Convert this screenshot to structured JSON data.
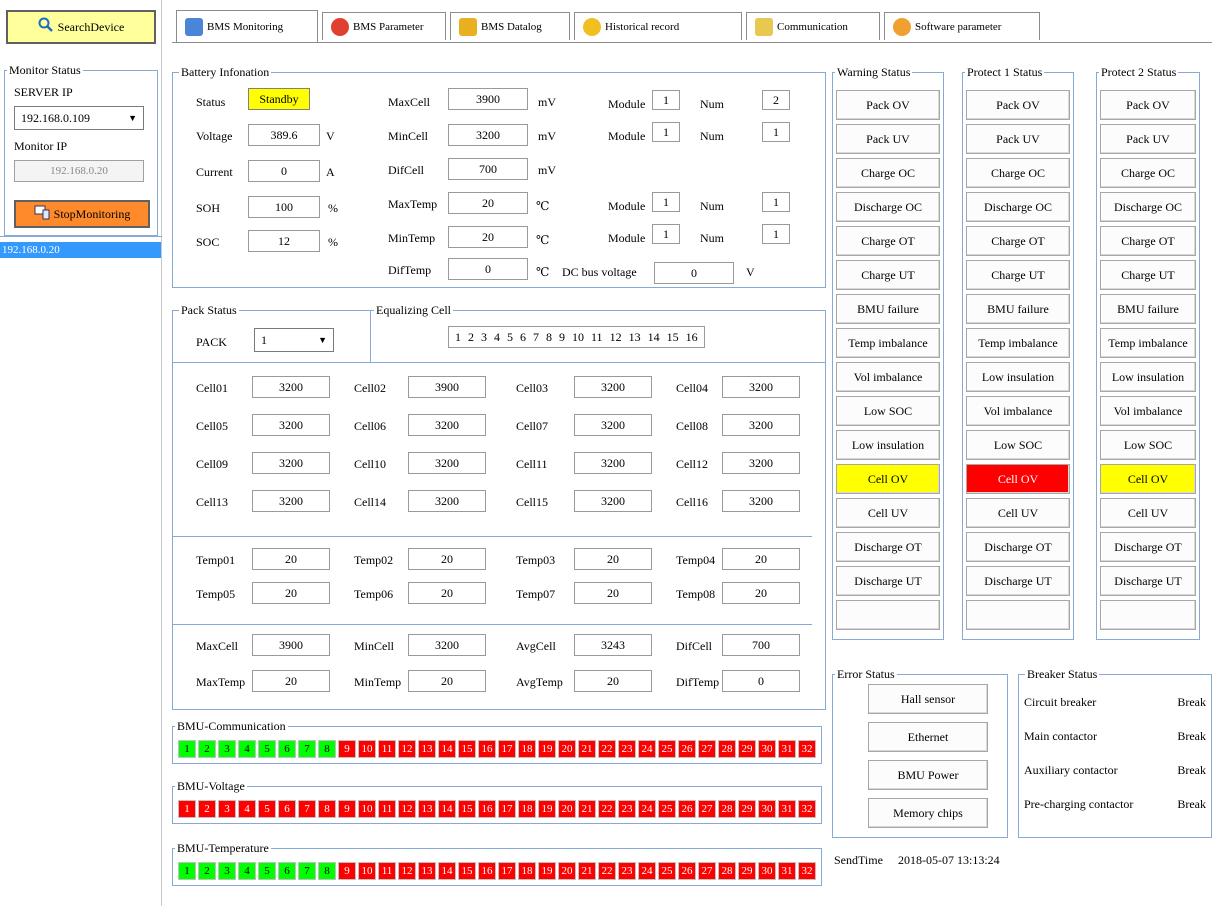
{
  "left": {
    "search_label": "SearchDevice",
    "monitor_status_title": "Monitor Status",
    "server_ip_label": "SERVER IP",
    "server_ip_value": "192.168.0.109",
    "monitor_ip_label": "Monitor IP",
    "monitor_ip_value": "192.168.0.20",
    "stop_label": "StopMonitoring",
    "devices": [
      "192.168.0.20"
    ]
  },
  "tabs": [
    {
      "label": "BMS Monitoring",
      "active": true
    },
    {
      "label": "BMS Parameter"
    },
    {
      "label": "BMS Datalog"
    },
    {
      "label": "Historical record"
    },
    {
      "label": "Communication"
    },
    {
      "label": "Software parameter"
    }
  ],
  "battery": {
    "title": "Battery Infonation",
    "status_label": "Status",
    "status_value": "Standby",
    "voltage_label": "Voltage",
    "voltage_value": "389.6",
    "voltage_unit": "V",
    "current_label": "Current",
    "current_value": "0",
    "current_unit": "A",
    "soh_label": "SOH",
    "soh_value": "100",
    "soh_unit": "%",
    "soc_label": "SOC",
    "soc_value": "12",
    "soc_unit": "%",
    "maxcell_label": "MaxCell",
    "maxcell_value": "3900",
    "maxcell_unit": "mV",
    "mincell_label": "MinCell",
    "mincell_value": "3200",
    "mincell_unit": "mV",
    "difcell_label": "DifCell",
    "difcell_value": "700",
    "difcell_unit": "mV",
    "maxtemp_label": "MaxTemp",
    "maxtemp_value": "20",
    "maxtemp_unit": "℃",
    "mintemp_label": "MinTemp",
    "mintemp_value": "20",
    "mintemp_unit": "℃",
    "diftemp_label": "DifTemp",
    "diftemp_value": "0",
    "diftemp_unit": "℃",
    "module_label": "Module",
    "num_label": "Num",
    "maxcell_module": "1",
    "maxcell_num": "2",
    "mincell_module": "1",
    "mincell_num": "1",
    "maxtemp_module": "1",
    "maxtemp_num": "1",
    "mintemp_module": "1",
    "mintemp_num": "1",
    "dcbus_label": "DC bus voltage",
    "dcbus_value": "0",
    "dcbus_unit": "V"
  },
  "pack": {
    "title": "Pack Status",
    "pack_label": "PACK",
    "pack_value": "1",
    "equalizing_title": "Equalizing Cell",
    "equalizing_cells": [
      "1",
      "2",
      "3",
      "4",
      "5",
      "6",
      "7",
      "8",
      "9",
      "10",
      "11",
      "12",
      "13",
      "14",
      "15",
      "16"
    ],
    "cells": [
      {
        "label": "Cell01",
        "value": "3200"
      },
      {
        "label": "Cell02",
        "value": "3900"
      },
      {
        "label": "Cell03",
        "value": "3200"
      },
      {
        "label": "Cell04",
        "value": "3200"
      },
      {
        "label": "Cell05",
        "value": "3200"
      },
      {
        "label": "Cell06",
        "value": "3200"
      },
      {
        "label": "Cell07",
        "value": "3200"
      },
      {
        "label": "Cell08",
        "value": "3200"
      },
      {
        "label": "Cell09",
        "value": "3200"
      },
      {
        "label": "Cell10",
        "value": "3200"
      },
      {
        "label": "Cell11",
        "value": "3200"
      },
      {
        "label": "Cell12",
        "value": "3200"
      },
      {
        "label": "Cell13",
        "value": "3200"
      },
      {
        "label": "Cell14",
        "value": "3200"
      },
      {
        "label": "Cell15",
        "value": "3200"
      },
      {
        "label": "Cell16",
        "value": "3200"
      }
    ],
    "temps": [
      {
        "label": "Temp01",
        "value": "20"
      },
      {
        "label": "Temp02",
        "value": "20"
      },
      {
        "label": "Temp03",
        "value": "20"
      },
      {
        "label": "Temp04",
        "value": "20"
      },
      {
        "label": "Temp05",
        "value": "20"
      },
      {
        "label": "Temp06",
        "value": "20"
      },
      {
        "label": "Temp07",
        "value": "20"
      },
      {
        "label": "Temp08",
        "value": "20"
      }
    ],
    "summary": [
      {
        "label": "MaxCell",
        "value": "3900"
      },
      {
        "label": "MinCell",
        "value": "3200"
      },
      {
        "label": "AvgCell",
        "value": "3243"
      },
      {
        "label": "DifCell",
        "value": "700"
      },
      {
        "label": "MaxTemp",
        "value": "20"
      },
      {
        "label": "MinTemp",
        "value": "20"
      },
      {
        "label": "AvgTemp",
        "value": "20"
      },
      {
        "label": "DifTemp",
        "value": "0"
      }
    ]
  },
  "bmu": {
    "communication_title": "BMU-Communication",
    "voltage_title": "BMU-Voltage",
    "temperature_title": "BMU-Temperature",
    "communication": [
      "ok",
      "ok",
      "ok",
      "ok",
      "ok",
      "ok",
      "ok",
      "ok",
      "bad",
      "bad",
      "bad",
      "bad",
      "bad",
      "bad",
      "bad",
      "bad",
      "bad",
      "bad",
      "bad",
      "bad",
      "bad",
      "bad",
      "bad",
      "bad",
      "bad",
      "bad",
      "bad",
      "bad",
      "bad",
      "bad",
      "bad",
      "bad"
    ],
    "voltage": [
      "bad",
      "bad",
      "bad",
      "bad",
      "bad",
      "bad",
      "bad",
      "bad",
      "bad",
      "bad",
      "bad",
      "bad",
      "bad",
      "bad",
      "bad",
      "bad",
      "bad",
      "bad",
      "bad",
      "bad",
      "bad",
      "bad",
      "bad",
      "bad",
      "bad",
      "bad",
      "bad",
      "bad",
      "bad",
      "bad",
      "bad",
      "bad"
    ],
    "temperature": [
      "ok",
      "ok",
      "ok",
      "ok",
      "ok",
      "ok",
      "ok",
      "ok",
      "bad",
      "bad",
      "bad",
      "bad",
      "bad",
      "bad",
      "bad",
      "bad",
      "bad",
      "bad",
      "bad",
      "bad",
      "bad",
      "bad",
      "bad",
      "bad",
      "bad",
      "bad",
      "bad",
      "bad",
      "bad",
      "bad",
      "bad",
      "bad"
    ]
  },
  "warning": {
    "title": "Warning Status",
    "items": [
      {
        "label": "Pack OV"
      },
      {
        "label": "Pack UV"
      },
      {
        "label": "Charge OC"
      },
      {
        "label": "Discharge OC"
      },
      {
        "label": "Charge OT"
      },
      {
        "label": "Charge UT"
      },
      {
        "label": "BMU failure"
      },
      {
        "label": "Temp imbalance"
      },
      {
        "label": "Vol imbalance"
      },
      {
        "label": "Low SOC"
      },
      {
        "label": "Low insulation"
      },
      {
        "label": "Cell OV",
        "state": "yellow"
      },
      {
        "label": "Cell UV"
      },
      {
        "label": "Discharge OT"
      },
      {
        "label": "Discharge UT"
      },
      {
        "label": ""
      }
    ]
  },
  "protect1": {
    "title": "Protect 1 Status",
    "items": [
      {
        "label": "Pack OV"
      },
      {
        "label": "Pack UV"
      },
      {
        "label": "Charge OC"
      },
      {
        "label": "Discharge OC"
      },
      {
        "label": "Charge OT"
      },
      {
        "label": "Charge UT"
      },
      {
        "label": "BMU failure"
      },
      {
        "label": "Temp imbalance"
      },
      {
        "label": "Low insulation"
      },
      {
        "label": "Vol imbalance"
      },
      {
        "label": "Low SOC"
      },
      {
        "label": "Cell OV",
        "state": "red"
      },
      {
        "label": "Cell UV"
      },
      {
        "label": "Discharge OT"
      },
      {
        "label": "Discharge UT"
      },
      {
        "label": ""
      }
    ]
  },
  "protect2": {
    "title": "Protect 2 Status",
    "items": [
      {
        "label": "Pack OV"
      },
      {
        "label": "Pack UV"
      },
      {
        "label": "Charge OC"
      },
      {
        "label": "Discharge OC"
      },
      {
        "label": "Charge OT"
      },
      {
        "label": "Charge UT"
      },
      {
        "label": "BMU failure"
      },
      {
        "label": "Temp imbalance"
      },
      {
        "label": "Low insulation"
      },
      {
        "label": "Vol imbalance"
      },
      {
        "label": "Low SOC"
      },
      {
        "label": "Cell OV",
        "state": "yellow"
      },
      {
        "label": "Cell UV"
      },
      {
        "label": "Discharge OT"
      },
      {
        "label": "Discharge UT"
      },
      {
        "label": ""
      }
    ]
  },
  "error": {
    "title": "Error Status",
    "items": [
      "Hall sensor",
      "Ethernet",
      "BMU Power",
      "Memory chips"
    ]
  },
  "breaker": {
    "title": "Breaker Status",
    "items": [
      {
        "label": "Circuit breaker",
        "value": "Break"
      },
      {
        "label": "Main contactor",
        "value": "Break"
      },
      {
        "label": "Auxiliary  contactor",
        "value": "Break"
      },
      {
        "label": "Pre-charging contactor",
        "value": "Break"
      }
    ]
  },
  "sendtime": {
    "label": "SendTime",
    "value": "2018-05-07 13:13:24"
  }
}
